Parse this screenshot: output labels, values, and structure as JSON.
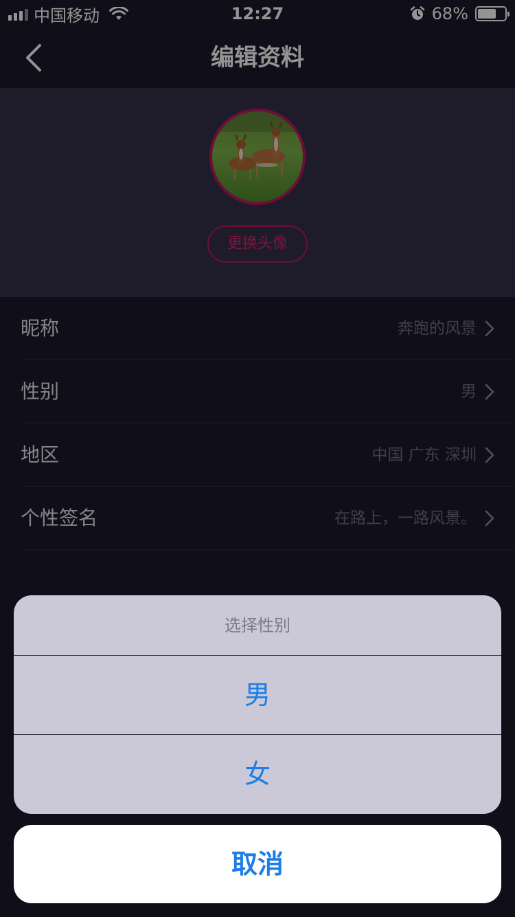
{
  "status_bar": {
    "carrier": "中国移动",
    "time": "12:27",
    "battery": "68%",
    "battery_level": 0.68,
    "icons": [
      "signal-icon",
      "wifi-icon",
      "alarm-icon",
      "battery-icon"
    ]
  },
  "nav": {
    "title": "编辑资料",
    "back_icon": "chevron-left-icon"
  },
  "profile": {
    "avatar_desc": "deer-photo-avatar",
    "change_avatar_label": "更换头像"
  },
  "settings": {
    "items": [
      {
        "label": "昵称",
        "value": "奔跑的风景"
      },
      {
        "label": "性别",
        "value": "男"
      },
      {
        "label": "地区",
        "value": "中国 广东 深圳"
      },
      {
        "label": "个性签名",
        "value": "在路上，一路风景。"
      }
    ]
  },
  "action_sheet": {
    "title": "选择性别",
    "options": [
      "男",
      "女"
    ],
    "cancel_label": "取消"
  },
  "colors": {
    "accent": "#c2185b",
    "action_blue": "#1e7de6",
    "background": "#1c1a2c"
  }
}
